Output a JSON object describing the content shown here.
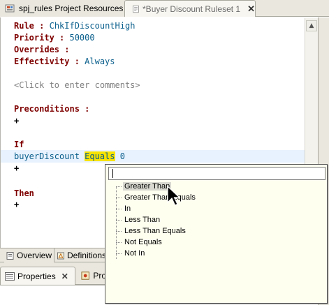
{
  "tabs": {
    "resources": "spj_rules Project Resources",
    "ruleset": "*Buyer Discount Ruleset 1",
    "close_glyph": "✕"
  },
  "rule": {
    "rule_label": "Rule :",
    "rule_name": "ChkIfDiscountHigh",
    "priority_label": "Priority :",
    "priority_value": "50000",
    "overrides_label": "Overrides :",
    "effectivity_label": "Effectivity :",
    "effectivity_value": "Always",
    "comments_placeholder": "<Click to enter comments>",
    "preconditions_label": "Preconditions :",
    "if_label": "If",
    "condition_field": "buyerDiscount",
    "condition_operator": "Equals",
    "condition_value": "0",
    "then_label": "Then",
    "add_glyph": "+"
  },
  "bottom_tabs": {
    "overview": "Overview",
    "definitions": "Definitions"
  },
  "properties": {
    "tab_label": "Properties",
    "second_tab_label": "Pro",
    "close_glyph": "✕"
  },
  "popup": {
    "filter_value": "",
    "options": [
      "Greater Than",
      "Greater Than Equals",
      "In",
      "Less Than",
      "Less Than Equals",
      "Not Equals",
      "Not In"
    ],
    "selected": "Greater Than"
  },
  "colors": {
    "keyword": "#7f0000",
    "value": "#0a5f8c",
    "highlight": "#f8e200",
    "chrome": "#e9e7de",
    "popup_bg": "#fffff0"
  }
}
